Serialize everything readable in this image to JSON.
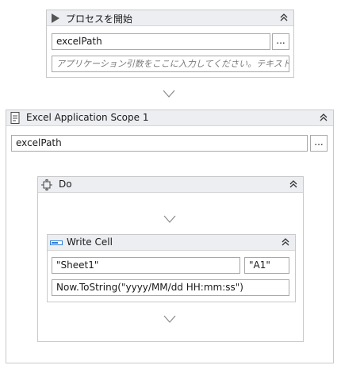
{
  "start_process": {
    "title": "プロセスを開始",
    "path_value": "excelPath",
    "browse_label": "...",
    "args_placeholder": "アプリケーション引数をここに入力してください。テキストは引用符"
  },
  "excel_scope": {
    "title": "Excel Application Scope 1",
    "path_value": "excelPath",
    "browse_label": "..."
  },
  "do_block": {
    "title": "Do"
  },
  "write_cell": {
    "title": "Write Cell",
    "sheet_value": "\"Sheet1\"",
    "range_value": "\"A1\"",
    "value_expr": "Now.ToString(\"yyyy/MM/dd HH:mm:ss\")"
  },
  "icons": {
    "start": "play-icon",
    "scope": "document-icon",
    "do": "sequence-icon",
    "write": "write-cell-icon",
    "collapse": "double-chevron-up-icon",
    "drop": "chevron-down-icon"
  },
  "colors": {
    "header_bg": "#eceef1",
    "border": "#c9c9c9",
    "field_border": "#a8a8a8",
    "write_icon": "#2f7fd4"
  }
}
